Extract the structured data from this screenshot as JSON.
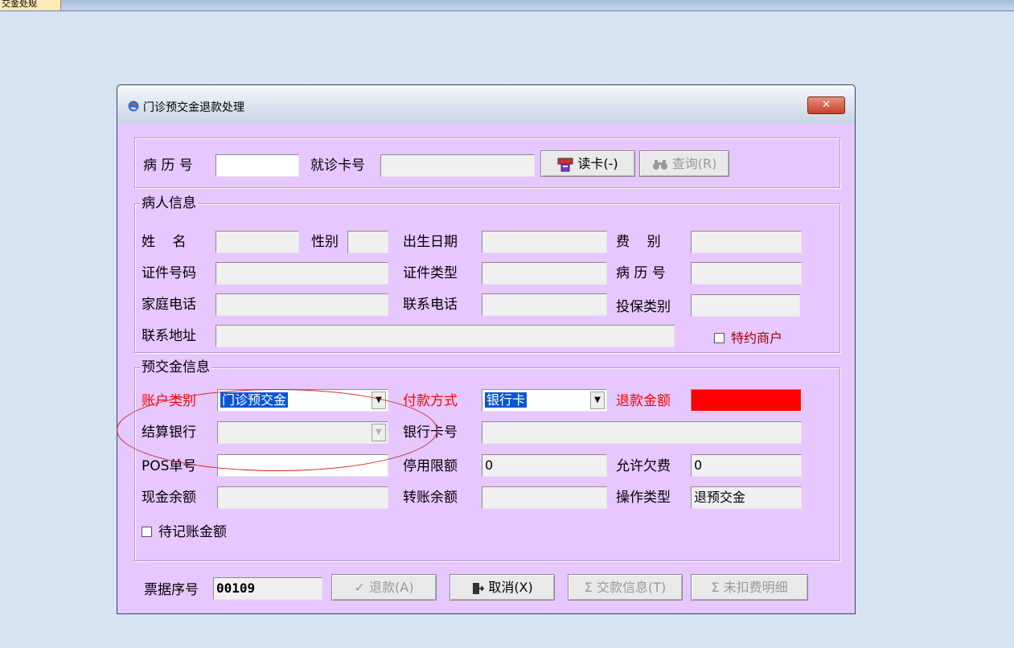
{
  "topbar": {
    "tab_label": "交金处规"
  },
  "window": {
    "title": "门诊预交金退款处理",
    "close_label": "✕"
  },
  "search": {
    "record_no_label": "病 历 号",
    "record_no_value": "",
    "card_no_label": "就诊卡号",
    "card_no_value": "",
    "read_card_button": "读卡(-)",
    "query_button": "查询(R)"
  },
  "patient": {
    "legend": "病人信息",
    "name_label": "姓    名",
    "name_value": "",
    "gender_label": "性别",
    "gender_value": "",
    "birth_label": "出生日期",
    "birth_value": "",
    "fee_type_label": "费    别",
    "fee_type_value": "",
    "id_no_label": "证件号码",
    "id_no_value": "",
    "id_type_label": "证件类型",
    "id_type_value": "",
    "record_no_label": "病 历 号",
    "record_no_value": "",
    "home_phone_label": "家庭电话",
    "home_phone_value": "",
    "contact_phone_label": "联系电话",
    "contact_phone_value": "",
    "insurance_label": "投保类别",
    "insurance_value": "",
    "address_label": "联系地址",
    "address_value": "",
    "special_merchant_label": "特约商户"
  },
  "deposit": {
    "legend": "预交金信息",
    "account_type_label": "账户类别",
    "account_type_value": "门诊预交金",
    "pay_method_label": "付款方式",
    "pay_method_value": "银行卡",
    "refund_amount_label": "退款金额",
    "refund_amount_value": "",
    "settle_bank_label": "结算银行",
    "settle_bank_value": "",
    "bank_card_label": "银行卡号",
    "bank_card_value": "",
    "pos_no_label": "POS单号",
    "pos_no_value": "",
    "stop_limit_label": "停用限额",
    "stop_limit_value": "0",
    "allow_debt_label": "允许欠费",
    "allow_debt_value": "0",
    "cash_balance_label": "现金余额",
    "cash_balance_value": "",
    "transfer_balance_label": "转账余额",
    "transfer_balance_value": "",
    "op_type_label": "操作类型",
    "op_type_value": "退预交金",
    "pending_amount_label": "待记账金额"
  },
  "footer": {
    "receipt_no_label": "票据序号",
    "receipt_no_value": "00109",
    "refund_button": "退款(A)",
    "cancel_button": "取消(X)",
    "payment_info_button": "交款信息(T)",
    "undeducted_button": "未扣费明细"
  },
  "colors": {
    "form_background": "#e6c7ff",
    "desktop_background": "#d6e3f0",
    "required_label": "#ff0000",
    "refund_amount_fill": "#ff0000",
    "annotation_circle": "#cc2222"
  }
}
